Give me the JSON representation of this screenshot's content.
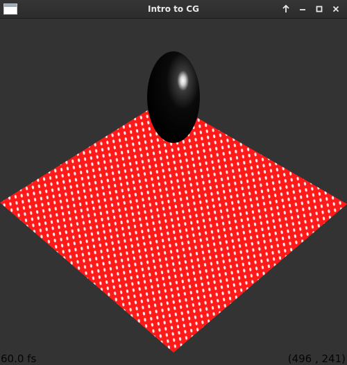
{
  "window": {
    "title": "Intro to CG",
    "icons": {
      "app": "window-icon",
      "keep_above": "arrow-up-icon",
      "minimize": "minimize-icon",
      "maximize": "maximize-icon",
      "close": "close-icon"
    }
  },
  "scene": {
    "background_color": "#333333",
    "floor_color": "#ff1a1a",
    "floor_highlight_color": "#ffffff",
    "sphere_color": "#000000"
  },
  "overlay": {
    "fps_text": "60.0 fs",
    "coords_text": "(496 , 241)"
  }
}
